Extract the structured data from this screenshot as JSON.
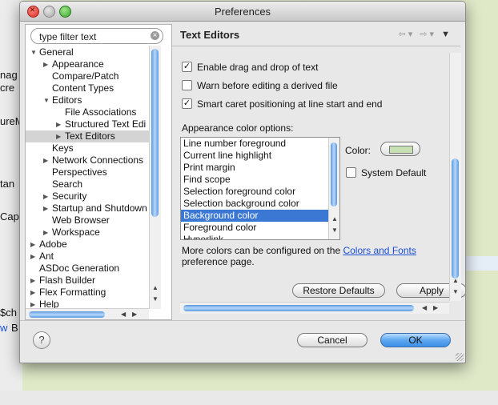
{
  "background": {
    "fragments": [
      "nag",
      "cre",
      "ureM",
      "tan",
      "Cap",
      "$ch",
      "w",
      "B"
    ]
  },
  "window": {
    "title": "Preferences"
  },
  "filter": {
    "value": "type filter text"
  },
  "tree": [
    {
      "label": "General",
      "level": 0,
      "twisty": "open"
    },
    {
      "label": "Appearance",
      "level": 1,
      "twisty": "closed"
    },
    {
      "label": "Compare/Patch",
      "level": 1,
      "twisty": "none"
    },
    {
      "label": "Content Types",
      "level": 1,
      "twisty": "none"
    },
    {
      "label": "Editors",
      "level": 1,
      "twisty": "open"
    },
    {
      "label": "File Associations",
      "level": 2,
      "twisty": "none"
    },
    {
      "label": "Structured Text Edi",
      "level": 2,
      "twisty": "closed"
    },
    {
      "label": "Text Editors",
      "level": 2,
      "twisty": "closed",
      "selected": true
    },
    {
      "label": "Keys",
      "level": 1,
      "twisty": "none"
    },
    {
      "label": "Network Connections",
      "level": 1,
      "twisty": "closed"
    },
    {
      "label": "Perspectives",
      "level": 1,
      "twisty": "none"
    },
    {
      "label": "Search",
      "level": 1,
      "twisty": "none"
    },
    {
      "label": "Security",
      "level": 1,
      "twisty": "closed"
    },
    {
      "label": "Startup and Shutdown",
      "level": 1,
      "twisty": "closed"
    },
    {
      "label": "Web Browser",
      "level": 1,
      "twisty": "none"
    },
    {
      "label": "Workspace",
      "level": 1,
      "twisty": "closed"
    },
    {
      "label": "Adobe",
      "level": 0,
      "twisty": "closed"
    },
    {
      "label": "Ant",
      "level": 0,
      "twisty": "closed"
    },
    {
      "label": "ASDoc Generation",
      "level": 0,
      "twisty": "none"
    },
    {
      "label": "Flash Builder",
      "level": 0,
      "twisty": "closed"
    },
    {
      "label": "Flex Formatting",
      "level": 0,
      "twisty": "closed"
    },
    {
      "label": "Help",
      "level": 0,
      "twisty": "closed"
    }
  ],
  "page": {
    "title": "Text Editors",
    "checkboxes": [
      {
        "label": "Enable drag and drop of text",
        "checked": true
      },
      {
        "label": "Warn before editing a derived file",
        "checked": false
      },
      {
        "label": "Smart caret positioning at line start and end",
        "checked": true
      }
    ],
    "appearance_label": "Appearance color options:",
    "color_options": [
      "Line number foreground",
      "Current line highlight",
      "Print margin",
      "Find scope",
      "Selection foreground color",
      "Selection background color",
      "Background color",
      "Foreground color",
      "Hyperlink"
    ],
    "selected_color_option": "Background color",
    "color_label": "Color:",
    "color_value": "#c7e0b4",
    "system_default_label": "System Default",
    "system_default_checked": false,
    "more_prefix": "More colors can be configured on the ",
    "more_link": "Colors and Fonts",
    "more_suffix": " preference page.",
    "restore_label": "Restore Defaults",
    "apply_label": "Apply"
  },
  "footer": {
    "help_label": "?",
    "cancel_label": "Cancel",
    "ok_label": "OK"
  }
}
